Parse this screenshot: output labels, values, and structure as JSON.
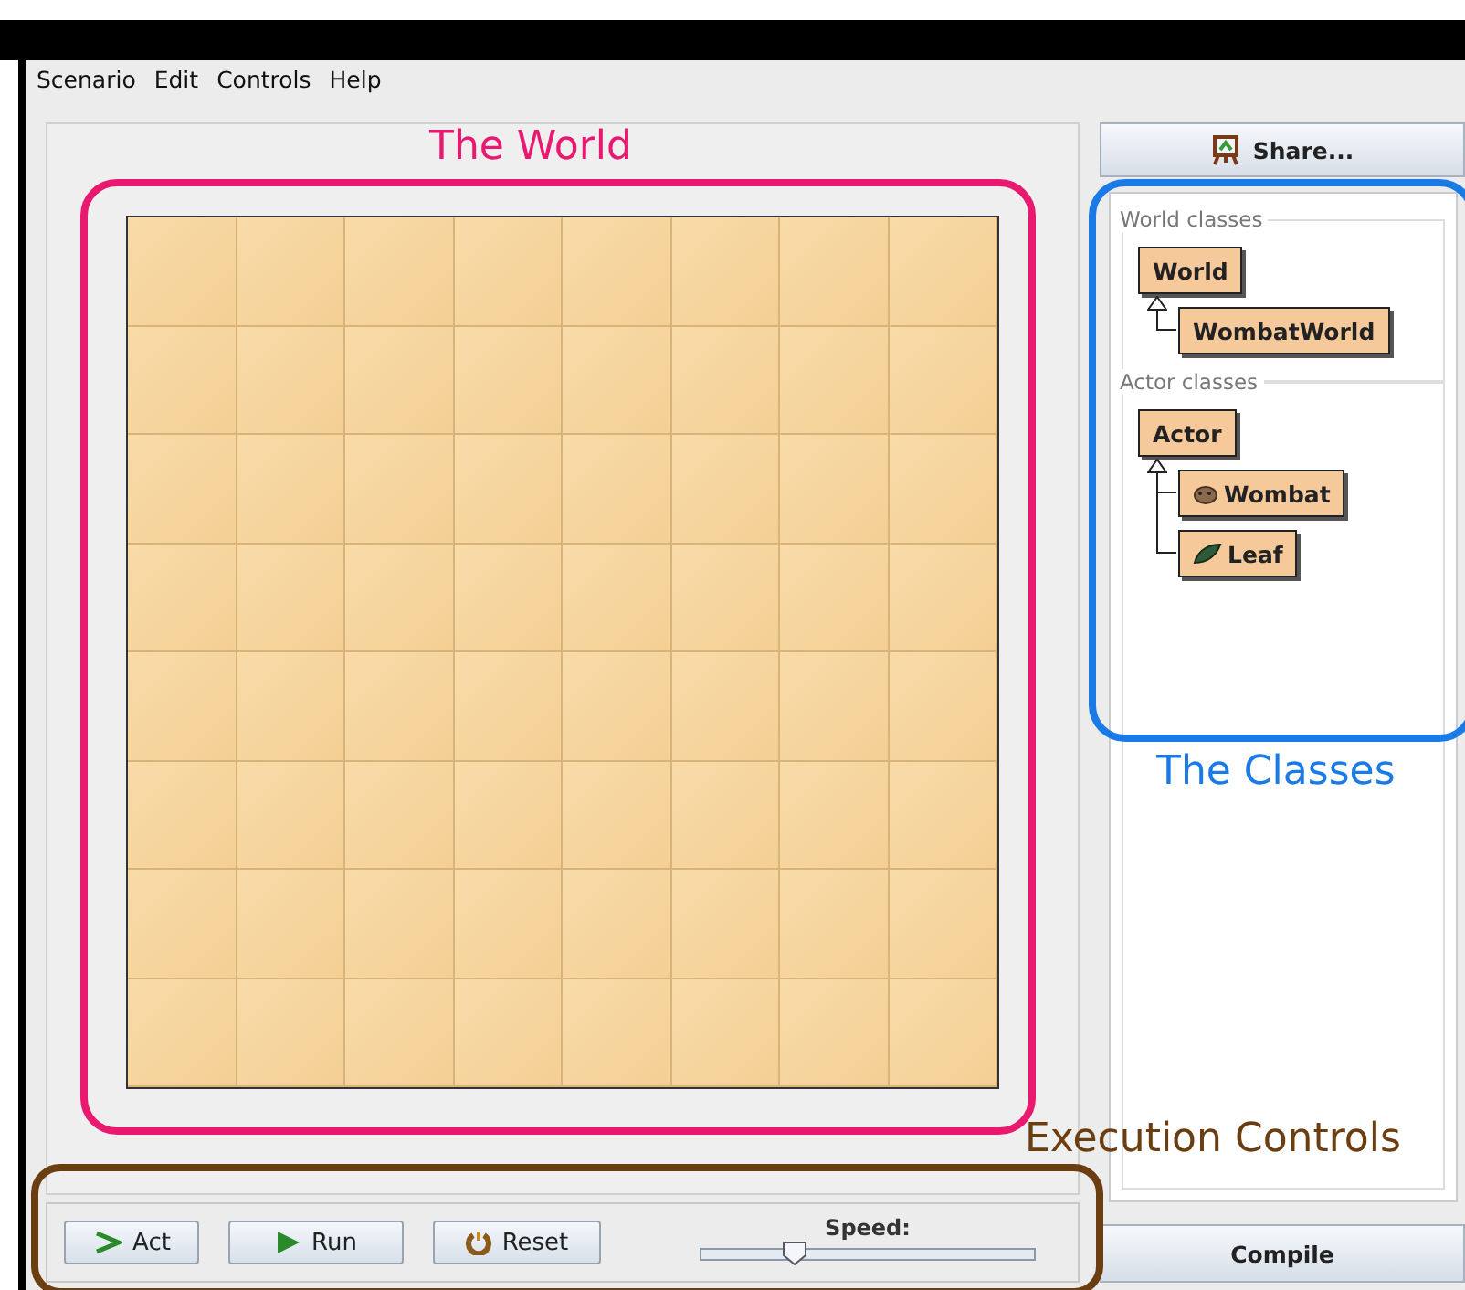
{
  "menu": [
    "Scenario",
    "Edit",
    "Controls",
    "Help"
  ],
  "share_button": {
    "label": "Share..."
  },
  "class_groups": [
    {
      "title": "World classes",
      "classes": [
        {
          "name": "World",
          "children": [
            {
              "name": "WombatWorld"
            }
          ]
        }
      ]
    },
    {
      "title": "Actor classes",
      "classes": [
        {
          "name": "Actor",
          "children": [
            {
              "name": "Wombat",
              "kind": "wombat"
            },
            {
              "name": "Leaf",
              "kind": "leaf"
            }
          ]
        }
      ]
    }
  ],
  "controls": [
    {
      "label": "Act",
      "kind": "act"
    },
    {
      "label": "Run",
      "kind": "run"
    },
    {
      "label": "Reset",
      "kind": "reset"
    }
  ],
  "speed": {
    "label": "Speed:",
    "level": 0.28
  },
  "compile_button": {
    "label": "Compile"
  },
  "annotations": [
    {
      "label": "The World",
      "kind": "world",
      "color": "#e8196e"
    },
    {
      "label": "The Classes",
      "kind": "classes",
      "color": "#1a7ae6"
    },
    {
      "label": "Execution Controls",
      "kind": "controls",
      "color": "#6b3e12"
    }
  ]
}
